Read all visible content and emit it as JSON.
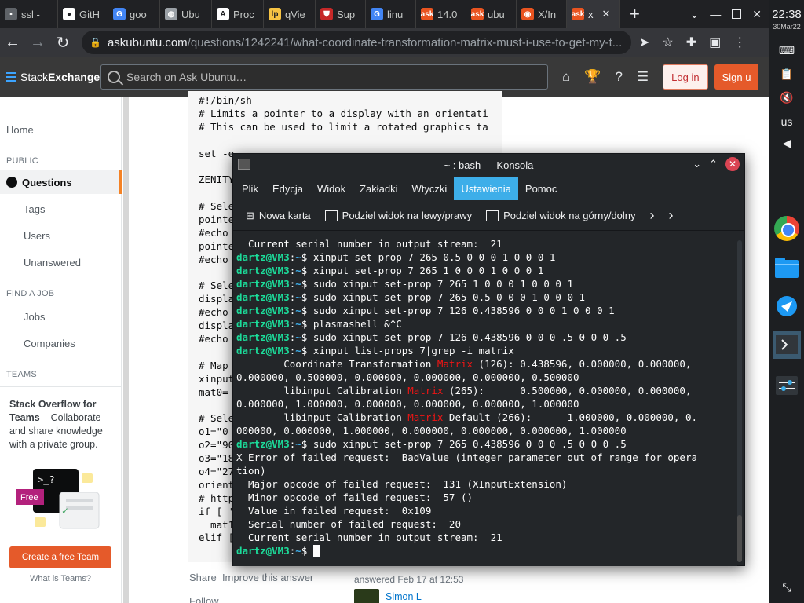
{
  "browser": {
    "tabs": [
      {
        "label": "ssl -",
        "icon": "generic-icon",
        "color": "#5f6368",
        "glyph": "▪"
      },
      {
        "label": "GitH",
        "icon": "github-icon",
        "color": "#ffffff",
        "glyph": "●"
      },
      {
        "label": "goo",
        "icon": "google-icon",
        "color": "#4285f4",
        "glyph": "G"
      },
      {
        "label": "Ubu",
        "icon": "globe-icon",
        "color": "#9aa0a6",
        "glyph": "◍"
      },
      {
        "label": "Proc",
        "icon": "letter-a-icon",
        "color": "#ffffff",
        "glyph": "A"
      },
      {
        "label": "qVie",
        "icon": "qview-icon",
        "color": "#f6c343",
        "glyph": "lp"
      },
      {
        "label": "Sup",
        "icon": "shield-icon",
        "color": "#c62828",
        "glyph": "⛊"
      },
      {
        "label": "linu",
        "icon": "google-icon",
        "color": "#4285f4",
        "glyph": "G"
      },
      {
        "label": "14.0",
        "icon": "askubuntu-icon",
        "color": "#e95420",
        "glyph": "ask"
      },
      {
        "label": "ubu",
        "icon": "askubuntu-icon",
        "color": "#e95420",
        "glyph": "ask"
      },
      {
        "label": "X/In",
        "icon": "ubuntu-icon",
        "color": "#e95420",
        "glyph": "◉"
      },
      {
        "label": "x",
        "icon": "askubuntu-icon",
        "color": "#e95420",
        "glyph": "ask",
        "active": true
      }
    ],
    "new_tab": "+",
    "url_host": "askubuntu.com",
    "url_path": "/questions/1242241/what-coordinate-transformation-matrix-must-i-use-to-get-my-t..."
  },
  "se": {
    "logo_a": "Stack",
    "logo_b": "Exchange",
    "search_placeholder": "Search on Ask Ubuntu…",
    "login": "Log in",
    "signup": "Sign u"
  },
  "leftnav": {
    "home": "Home",
    "public": "PUBLIC",
    "questions": "Questions",
    "tags": "Tags",
    "users": "Users",
    "unanswered": "Unanswered",
    "find_job": "FIND A JOB",
    "jobs": "Jobs",
    "companies": "Companies",
    "teams": "TEAMS",
    "teams_title": "Stack Overflow for Teams",
    "teams_text": " – Collaborate and share knowledge with a private group.",
    "free_badge": "Free",
    "cta": "Create a free Team",
    "what": "What is Teams?"
  },
  "post": {
    "code_lines": [
      "#!/bin/sh",
      "# Limits a pointer to a display with an orientati",
      "# This can be used to limit a rotated graphics ta",
      "",
      "set -e",
      "",
      "ZENITY",
      "",
      "# Sele",
      "pointe",
      "#echo",
      "pointe",
      "#echo",
      "",
      "# Sele",
      "displa",
      "#echo",
      "displa",
      "#echo",
      "",
      "# Map",
      "xinput",
      "mat0=",
      "",
      "# Sele",
      "o1=\"0",
      "o2=\"90",
      "o3=\"18",
      "o4=\"27",
      "orient",
      "# http",
      "if [ '",
      "  mat1",
      "elif ["
    ],
    "share": "Share",
    "improve": "Improve this answer",
    "follow": "Follow",
    "answered": "answered Feb 17 at 12:53",
    "answerer": "Simon L"
  },
  "konsole": {
    "title": "~ : bash — Konsola",
    "menu": [
      "Plik",
      "Edycja",
      "Widok",
      "Zakładki",
      "Wtyczki",
      "Ustawienia",
      "Pomoc"
    ],
    "active_menu": "Ustawienia",
    "toolbar": {
      "new_tab": "Nowa karta",
      "split_lr": "Podziel widok na lewy/prawy",
      "split_tb": "Podziel widok na górny/dolny"
    },
    "prompt_user": "dartz@VM3",
    "prompt_path": "~",
    "lines": [
      {
        "t": "out",
        "text": "  Current serial number in output stream:  21"
      },
      {
        "t": "cmd",
        "text": "xinput set-prop 7 265 0.5 0 0 0 1 0 0 0 1"
      },
      {
        "t": "cmd",
        "text": "xinput set-prop 7 265 1 0 0 0 1 0 0 0 1"
      },
      {
        "t": "cmd",
        "text": "sudo xinput set-prop 7 265 1 0 0 0 1 0 0 0 1"
      },
      {
        "t": "cmd",
        "text": "sudo xinput set-prop 7 265 0.5 0 0 0 1 0 0 0 1"
      },
      {
        "t": "cmd",
        "text": "sudo xinput set-prop 7 126 0.438596 0 0 0 1 0 0 0 1"
      },
      {
        "t": "cmd",
        "text": "plasmashell &^C"
      },
      {
        "t": "cmd",
        "text": "sudo xinput set-prop 7 126 0.438596 0 0 0 .5 0 0 0 .5"
      },
      {
        "t": "cmd",
        "text": "xinput list-props 7|grep -i matrix"
      },
      {
        "t": "m",
        "a": "        Coordinate Transformation ",
        "m": "Matrix",
        "b": " (126): 0.438596, 0.000000, 0.000000,"
      },
      {
        "t": "out",
        "text": "0.000000, 0.500000, 0.000000, 0.000000, 0.000000, 0.500000"
      },
      {
        "t": "m",
        "a": "        libinput Calibration ",
        "m": "Matrix",
        "b": " (265):      0.500000, 0.000000, 0.000000,"
      },
      {
        "t": "out",
        "text": "0.000000, 1.000000, 0.000000, 0.000000, 0.000000, 1.000000"
      },
      {
        "t": "m",
        "a": "        libinput Calibration ",
        "m": "Matrix",
        "b": " Default (266):      1.000000, 0.000000, 0."
      },
      {
        "t": "out",
        "text": "000000, 0.000000, 1.000000, 0.000000, 0.000000, 0.000000, 1.000000"
      },
      {
        "t": "cmd",
        "text": "sudo xinput set-prop 7 265 0.438596 0 0 0 .5 0 0 0 .5"
      },
      {
        "t": "out",
        "text": "X Error of failed request:  BadValue (integer parameter out of range for opera"
      },
      {
        "t": "out",
        "text": "tion)"
      },
      {
        "t": "out",
        "text": "  Major opcode of failed request:  131 (XInputExtension)"
      },
      {
        "t": "out",
        "text": "  Minor opcode of failed request:  57 ()"
      },
      {
        "t": "out",
        "text": "  Value in failed request:  0x109"
      },
      {
        "t": "out",
        "text": "  Serial number of failed request:  20"
      },
      {
        "t": "out",
        "text": "  Current serial number in output stream:  21"
      },
      {
        "t": "prompt"
      }
    ]
  },
  "panel": {
    "clock": "22:38",
    "date": "30Mar22",
    "lang": "us"
  }
}
